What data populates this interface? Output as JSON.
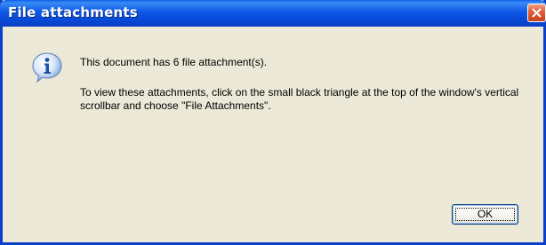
{
  "dialog": {
    "title": "File attachments",
    "icon": "info-icon",
    "message_line1": "This document has 6 file attachment(s).",
    "message_line2": "To view these attachments, click on the small black triangle at the top of the window's vertical scrollbar and choose \"File Attachments\".",
    "ok_label": "OK"
  },
  "colors": {
    "titlebar": "#0a5fe6",
    "window_bg": "#ece9d8",
    "close_button": "#e0603a"
  }
}
